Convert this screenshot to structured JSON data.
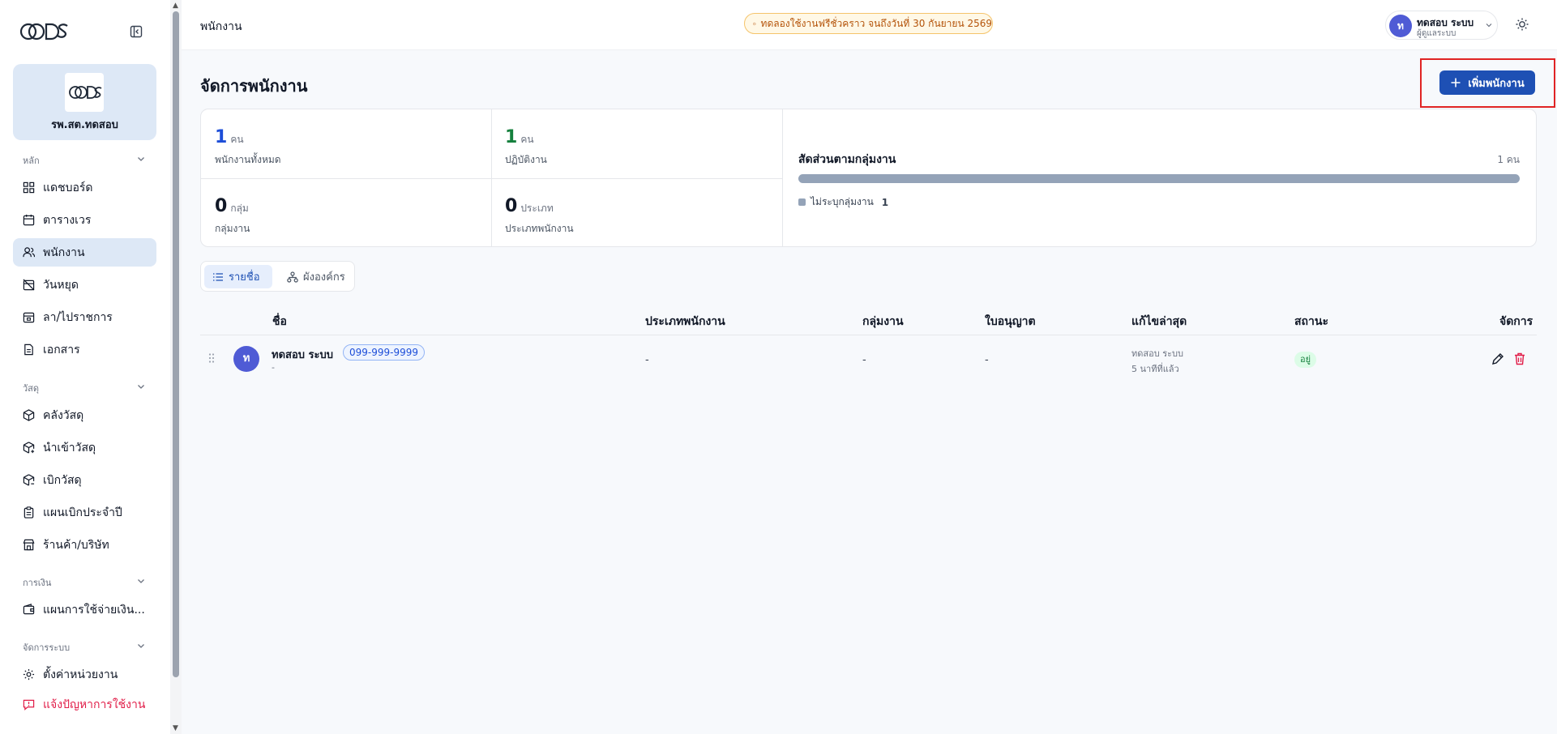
{
  "sidebar": {
    "org_name": "รพ.สต.ทดสอบ",
    "sections": [
      {
        "label": "หลัก"
      },
      {
        "label": "วัสดุ"
      },
      {
        "label": "การเงิน"
      },
      {
        "label": "จัดการระบบ"
      }
    ],
    "items": [
      {
        "label": "แดชบอร์ด",
        "icon": "dashboard-icon"
      },
      {
        "label": "ตารางเวร",
        "icon": "calendar-icon"
      },
      {
        "label": "พนักงาน",
        "icon": "users-icon",
        "active": true
      },
      {
        "label": "วันหยุด",
        "icon": "calendar-off-icon"
      },
      {
        "label": "ลา/ไปราชการ",
        "icon": "calendar-leave-icon"
      },
      {
        "label": "เอกสาร",
        "icon": "document-icon"
      },
      {
        "label": "คลังวัสดุ",
        "icon": "package-icon"
      },
      {
        "label": "นำเข้าวัสดุ",
        "icon": "package-import-icon"
      },
      {
        "label": "เบิกวัสดุ",
        "icon": "package-withdraw-icon"
      },
      {
        "label": "แผนเบิกประจำปี",
        "icon": "clipboard-icon"
      },
      {
        "label": "ร้านค้า/บริษัท",
        "icon": "store-icon"
      },
      {
        "label": "แผนการใช้จ่ายเงิน...",
        "icon": "wallet-icon"
      },
      {
        "label": "ตั้งค่าหน่วยงาน",
        "icon": "settings-icon"
      },
      {
        "label": "แจ้งปัญหาการใช้งาน",
        "icon": "alert-message-icon"
      }
    ]
  },
  "topbar": {
    "title": "พนักงาน",
    "trial_text": "ทดลองใช้งานฟรีชั่วคราว จนถึงวันที่ 30 กันยายน 2569",
    "user_initial": "ท",
    "user_name": "ทดสอบ ระบบ",
    "user_role": "ผู้ดูแลระบบ"
  },
  "main": {
    "page_title": "จัดการพนักงาน",
    "add_button": "เพิ่มพนักงาน",
    "stats": [
      {
        "value": "1",
        "unit": "คน",
        "label": "พนักงานทั้งหมด"
      },
      {
        "value": "1",
        "unit": "คน",
        "label": "ปฏิบัติงาน"
      },
      {
        "value": "0",
        "unit": "กลุ่ม",
        "label": "กลุ่มงาน"
      },
      {
        "value": "0",
        "unit": "ประเภท",
        "label": "ประเภทพนักงาน"
      }
    ],
    "ratio": {
      "title": "สัดส่วนตามกลุ่มงาน",
      "total": "1 คน",
      "legend_label": "ไม่ระบุกลุ่มงาน",
      "legend_value": "1",
      "fraction": 1.0
    },
    "tabs": [
      {
        "label": "รายชื่อ",
        "active": true
      },
      {
        "label": "ผังองค์กร",
        "active": false
      }
    ],
    "table": {
      "headers": {
        "name": "ชื่อ",
        "type": "ประเภทพนักงาน",
        "group": "กลุ่มงาน",
        "license": "ใบอนุญาต",
        "updated": "แก้ไขล่าสุด",
        "status": "สถานะ",
        "manage": "จัดการ"
      },
      "rows": [
        {
          "initial": "ท",
          "name": "ทดสอบ ระบบ",
          "phone": "099-999-9999",
          "sub": "-",
          "type": "-",
          "group": "-",
          "license": "-",
          "updated_by": "ทดสอบ ระบบ",
          "updated_ago": "5 นาทีที่แล้ว",
          "status": "อยู่"
        }
      ]
    }
  },
  "colors": {
    "primary": "#1e50b4",
    "sidebar_active": "#dde8f6",
    "alert": "#e11d48",
    "highlight": "#e02424"
  }
}
